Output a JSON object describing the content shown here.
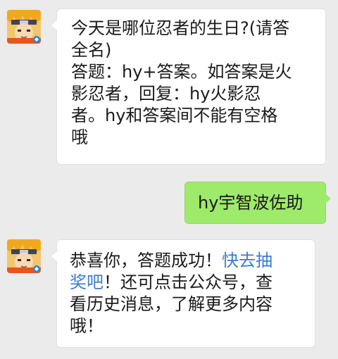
{
  "conversation": {
    "messages": [
      {
        "sender": "official-account",
        "avatar_icon": "ninja-avatar-icon",
        "lines": [
          "今天是哪位忍者的生日?(请答",
          "全名)",
          "答题：hy+答案。如答案是火",
          "影忍者，回复：hy火影忍",
          "者。hy和答案间不能有空格",
          "哦"
        ]
      },
      {
        "sender": "user",
        "text": "hy宇智波佐助"
      },
      {
        "sender": "official-account",
        "avatar_icon": "ninja-avatar-icon",
        "line1_prefix": "恭喜你，答题成功！",
        "line1_link": "快去抽",
        "line2_link": "奖吧",
        "line2_suffix": "！还可点击公众号，查",
        "lines_rest": [
          "看历史消息，了解更多内容",
          "哦！"
        ]
      }
    ]
  },
  "colors": {
    "background": "#ebebeb",
    "incoming_bubble": "#ffffff",
    "outgoing_bubble": "#9eea6a",
    "link": "#3a7bd5"
  }
}
